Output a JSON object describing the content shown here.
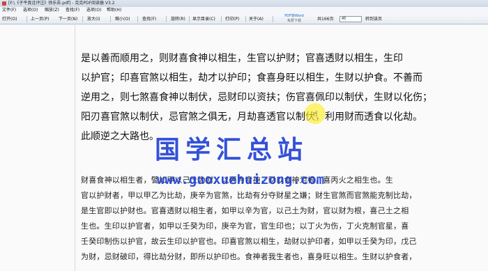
{
  "window": {
    "title": "[F:\\《子平真诠评注》徐乐吾.pdf] - 克克PDF阅读器 V3.2"
  },
  "menu": [
    "文件(F)",
    "选项(O)",
    "缩放(Z)",
    "查找(F)",
    "选项(O)",
    "帮助(H)"
  ],
  "toolbar": {
    "open": "打开(O)",
    "prev": "上一页(P)",
    "next": "下一页(N)",
    "zoom_in": "放大(I)",
    "zoom_out": "缩小(O)",
    "find": "查找(F)",
    "rotate": "旋转(R)",
    "toc": "显示目录(C)",
    "print": "打印(P)",
    "about": "关于(A)",
    "pdf_to_word": "PDF转Word",
    "pdf_to_word_sub": "免费下载",
    "page_total": "共166页",
    "page_input": "45",
    "goto": "转到该页"
  },
  "doc": {
    "large_lines": [
      "是以善而顺用之，则财喜食神以相生，生官以护财；官喜透财以相生，生印",
      "以护官；印喜官煞以相生，劫才以护印；食喜身旺以相生，生财以护食。不善而",
      "逆用之，则七煞喜食神以制伏，忌财印以资扶；伤官喜佩印以制伏，生财以化伤；",
      "阳刃喜官煞以制伏，忌官煞之俱无，月劫喜透官以制伏，利用财而透食以化劫。",
      "此顺逆之大路也。"
    ],
    "small_lines": [
      "财喜食神以相生者，譬如甲以己土为财，以丙为食神，财以食神为根，喜丙火之相生也。生",
      "官以护财者，甲以甲乙为比劫，庚辛为官煞，比劫有分夺财星之嫌；财生官煞而官煞能克制比劫，",
      "是生官即以护财也。官喜透财以相生者，如甲以辛为官，以己土为财，官以财为根，喜己土之相",
      "生也。生印以护官者，如甲以壬癸为印，庚辛为官，官生印也；以丁火为伤，丁火克制官星，喜",
      "壬癸印制伤以护官，故云生印以护官也。印喜官煞以相生，劫财以护印者，如甲以壬癸为印，戊己",
      "为财，忌财破印，得比劫分财，即所以护印也。食神者我生者也，喜身旺以相生。生财以护食者，"
    ]
  },
  "watermark": {
    "cn": "国学汇总站",
    "url": "www.guoxuehuizong.com"
  },
  "colors": {
    "watermark": "#1e3fd6",
    "cursor_highlight": "#ffee28"
  }
}
